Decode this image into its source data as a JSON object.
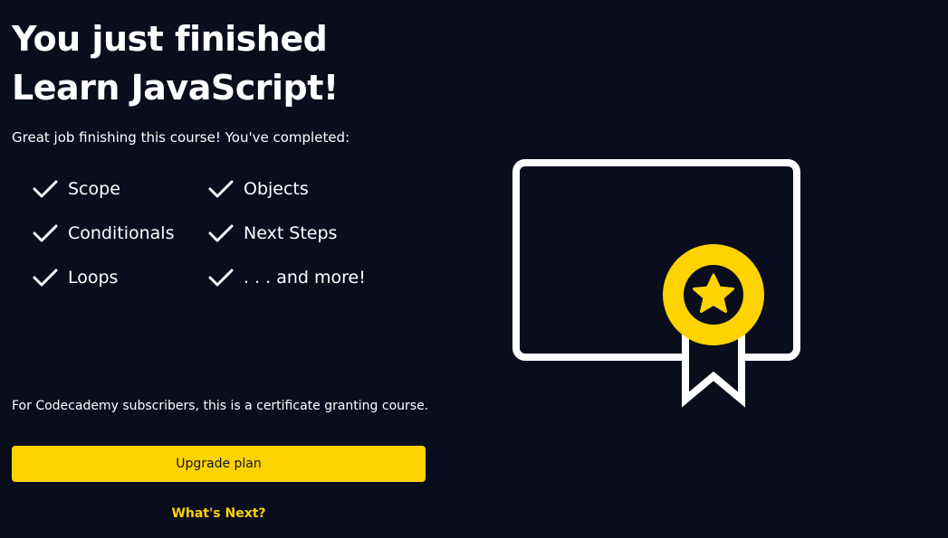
{
  "heading": {
    "line1": "You just finished",
    "line2": "Learn JavaScript!"
  },
  "intro": "Great job finishing this course! You've completed:",
  "topics": [
    {
      "label": "Scope",
      "icon": "check-icon"
    },
    {
      "label": "Objects",
      "icon": "check-icon"
    },
    {
      "label": "Conditionals",
      "icon": "check-icon"
    },
    {
      "label": "Next Steps",
      "icon": "check-icon"
    },
    {
      "label": "Loops",
      "icon": "check-icon"
    },
    {
      "label": ". . . and more!",
      "icon": "check-icon"
    }
  ],
  "subscriber_note": "For Codecademy subscribers, this is a certificate granting course.",
  "actions": {
    "upgrade_label": "Upgrade plan",
    "whats_next_label": "What's Next?"
  },
  "illustration": {
    "icon": "certificate-award-icon"
  },
  "colors": {
    "background": "#0a0d1c",
    "accent": "#ffd300",
    "text": "#ffffff",
    "button_text": "#10162f"
  }
}
